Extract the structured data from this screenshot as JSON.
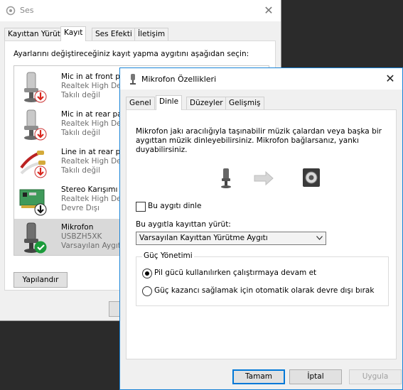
{
  "ses_window": {
    "title": "Ses",
    "close_glyph": "✕",
    "tabs": [
      "Kayıttan Yürüt",
      "Kayıt",
      "Ses Efekti",
      "İletişim"
    ],
    "active_tab": "Kayıt",
    "instruction": "Ayarlarını değiştireceğiniz kayıt yapma aygıtını aşağıdan seçin:",
    "devices": [
      {
        "name": "Mic in at front pa",
        "driver": "Realtek High Def",
        "status": "Takılı değil",
        "icon": "microphone-icon",
        "badge": "red-down-arrow-icon"
      },
      {
        "name": "Mic in at rear pa",
        "driver": "Realtek High Def",
        "status": "Takılı değil",
        "icon": "microphone-icon",
        "badge": "red-down-arrow-icon"
      },
      {
        "name": "Line in at rear pa",
        "driver": "Realtek High Def",
        "status": "Takılı değil",
        "icon": "line-in-cable-icon",
        "badge": "red-down-arrow-icon"
      },
      {
        "name": "Stereo Karışımı",
        "driver": "Realtek High Def",
        "status": "Devre Dışı",
        "icon": "sound-card-icon",
        "badge": "black-down-arrow-icon"
      },
      {
        "name": "Mikrofon",
        "driver": "USBZH5XK",
        "status": "Varsayılan Aygıt",
        "icon": "microphone-icon",
        "badge": "green-check-icon"
      }
    ],
    "selected_device": "Mikrofon",
    "configure_label": "Yapılandır"
  },
  "mic_dialog": {
    "title": "Mikrofon Özellikleri",
    "close_glyph": "✕",
    "tabs": [
      "Genel",
      "Dinle",
      "Düzeyler",
      "Gelişmiş"
    ],
    "active_tab": "Dinle",
    "description": "Mikrofon jakı aracılığıyla taşınabilir müzik çalardan veya başka bir aygıttan müzik dinleyebilirsiniz. Mikrofon bağlarsanız, yankı duyabilirsiniz.",
    "listen_checkbox_label": "Bu aygıtı dinle",
    "listen_checked": false,
    "playback_label": "Bu aygıtla kayıttan yürüt:",
    "playback_value": "Varsayılan Kayıttan Yürütme Aygıtı",
    "power_legend": "Güç Yönetimi",
    "power_options": [
      {
        "label": "Pil gücü kullanılırken çalıştırmaya devam et",
        "checked": true
      },
      {
        "label": "Güç kazancı sağlamak için otomatik olarak devre dışı bırak",
        "checked": false
      }
    ],
    "buttons": {
      "ok": "Tamam",
      "cancel": "İptal",
      "apply": "Uygula"
    }
  },
  "colors": {
    "accent": "#0078d7",
    "dialog_border": "#1883d7",
    "selected_row": "#d9d9d9",
    "status_red": "#d9271e",
    "status_green": "#1b9b3a"
  }
}
